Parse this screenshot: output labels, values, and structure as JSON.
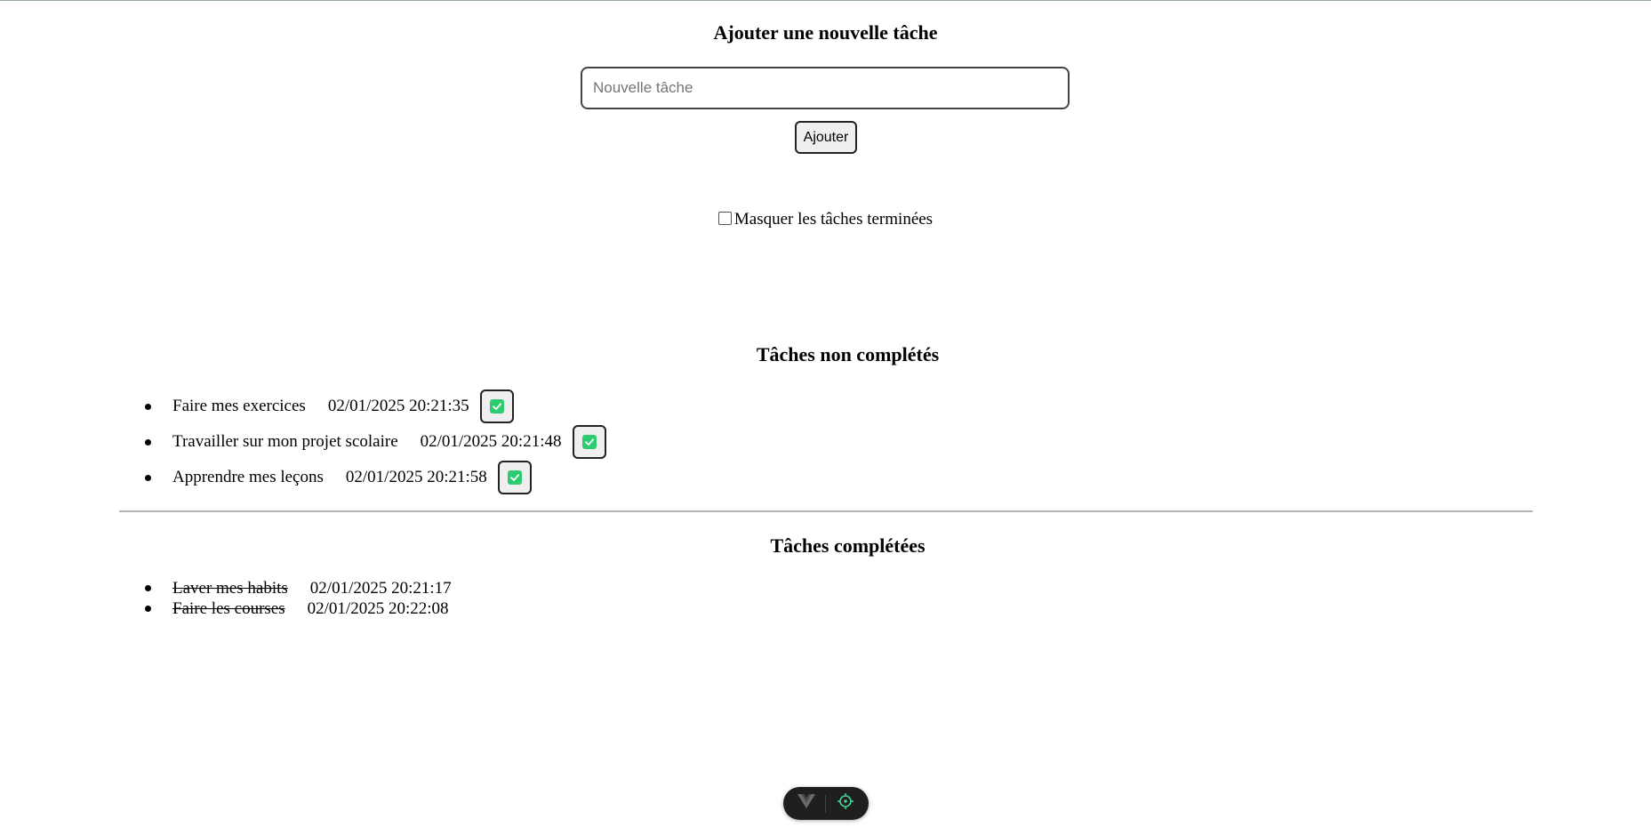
{
  "add_form": {
    "title": "Ajouter une nouvelle tâche",
    "input_placeholder": "Nouvelle tâche",
    "input_value": "",
    "add_button_label": "Ajouter"
  },
  "filter": {
    "hide_completed_label": "Masquer les tâches terminées",
    "hide_completed_checked": false
  },
  "pending": {
    "title": "Tâches non complétés",
    "tasks": [
      {
        "name": "Faire mes exercices",
        "date": "02/01/2025 20:21:35"
      },
      {
        "name": "Travailler sur mon projet scolaire",
        "date": "02/01/2025 20:21:48"
      },
      {
        "name": "Apprendre mes leçons",
        "date": "02/01/2025 20:21:58"
      }
    ]
  },
  "completed": {
    "title": "Tâches complétées",
    "tasks": [
      {
        "name": "Laver mes habits",
        "date": "02/01/2025 20:21:17"
      },
      {
        "name": "Faire les courses",
        "date": "02/01/2025 20:22:08"
      }
    ]
  },
  "icons": {
    "complete_icon": "check-square-icon",
    "devtools_logo": "vue-logo-icon",
    "devtools_inspect": "crosshair-icon"
  },
  "colors": {
    "check_green": "#2ecc71",
    "devtools_accent": "#42d392"
  }
}
